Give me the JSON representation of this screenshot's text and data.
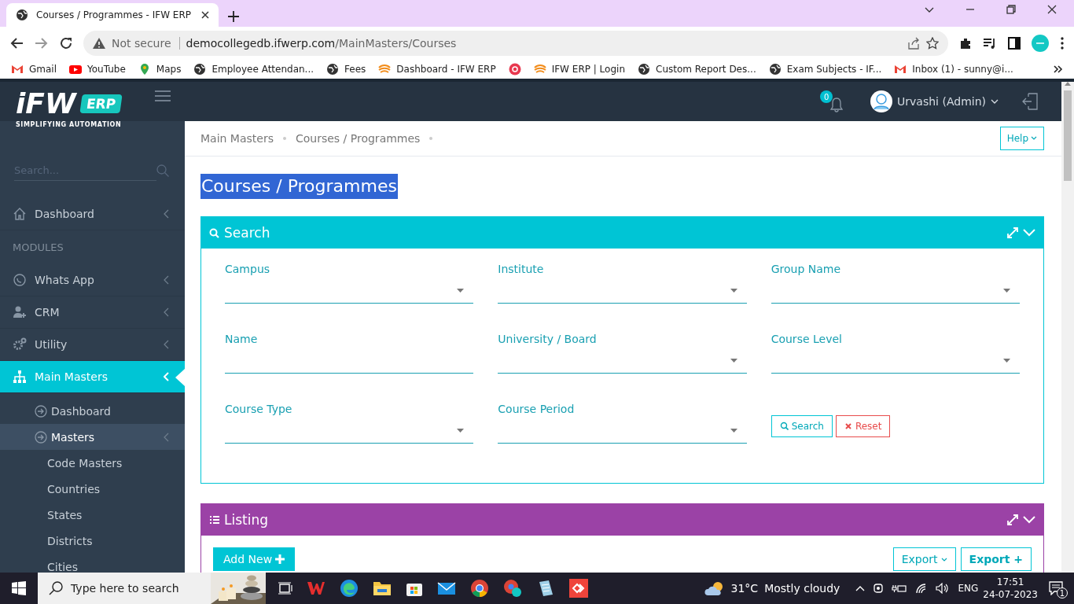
{
  "browser": {
    "tab": {
      "title": "Courses / Programmes - IFW ERP",
      "selected": true
    },
    "address": {
      "security": "Not secure",
      "host": "democollegedb.ifwerp.com",
      "path": "/MainMasters/Courses"
    },
    "bookmarks": [
      {
        "kind": "link",
        "label": "Gmail"
      },
      {
        "kind": "link",
        "label": "YouTube"
      },
      {
        "kind": "link",
        "label": "Maps"
      },
      {
        "kind": "link",
        "label": "Employee Attendan..."
      },
      {
        "kind": "link",
        "label": "Fees"
      },
      {
        "kind": "link",
        "label": "Dashboard - IFW ERP"
      },
      {
        "kind": "icon"
      },
      {
        "kind": "link",
        "label": "IFW ERP | Login"
      },
      {
        "kind": "link",
        "label": "Custom Report Des..."
      },
      {
        "kind": "link",
        "label": "Exam Subjects - IF..."
      },
      {
        "kind": "link",
        "label": "Inbox (1) - sunny@i..."
      }
    ]
  },
  "app": {
    "logo": {
      "name": "iFW",
      "badge": "ERP",
      "tagline": "SIMPLIFYING AUTOMATION"
    },
    "sidebar": {
      "search": {
        "placeholder": "Search..."
      },
      "items": [
        {
          "kind": "link",
          "label": "Dashboard",
          "selected": false
        },
        {
          "kind": "heading",
          "label": "MODULES"
        },
        {
          "kind": "link",
          "label": "Whats App",
          "selected": false
        },
        {
          "kind": "link",
          "label": "CRM",
          "selected": false
        },
        {
          "kind": "link",
          "label": "Utility",
          "selected": false
        },
        {
          "kind": "link",
          "label": "Main Masters",
          "selected": true,
          "children": [
            {
              "label": "Dashboard",
              "selected": false
            },
            {
              "label": "Masters",
              "selected": true,
              "children": [
                {
                  "label": "Code Masters",
                  "selected": false
                },
                {
                  "label": "Countries",
                  "selected": false
                },
                {
                  "label": "States",
                  "selected": false
                },
                {
                  "label": "Districts",
                  "selected": false
                },
                {
                  "label": "Cities",
                  "selected": false
                }
              ]
            }
          ]
        }
      ]
    },
    "header": {
      "notifications": "0",
      "user": "Urvashi (Admin)"
    },
    "breadcrumb": [
      "Main Masters",
      "Courses / Programmes"
    ],
    "help_button": "Help",
    "page_title": {
      "text": "Courses / Programmes",
      "highlighted": true
    },
    "panels": [
      {
        "kind": "search",
        "title": "Search",
        "color": "#00c5d5",
        "fields": [
          {
            "label": "Campus",
            "kind": "select"
          },
          {
            "label": "Institute",
            "kind": "select"
          },
          {
            "label": "Group Name",
            "kind": "select"
          },
          {
            "label": "Name",
            "kind": "text"
          },
          {
            "label": "University / Board",
            "kind": "select"
          },
          {
            "label": "Course Level",
            "kind": "select"
          },
          {
            "label": "Course Type",
            "kind": "select"
          },
          {
            "label": "Course Period",
            "kind": "select"
          }
        ],
        "buttons": [
          {
            "label": "Search",
            "kind": "search"
          },
          {
            "label": "Reset",
            "kind": "reset"
          }
        ]
      },
      {
        "kind": "listing",
        "title": "Listing",
        "color": "#9b42a6",
        "buttons": [
          {
            "label": "Add New",
            "kind": "add"
          },
          {
            "label": "Export",
            "kind": "dropdown"
          },
          {
            "label": "Export +",
            "kind": "outline"
          }
        ]
      }
    ]
  },
  "taskbar": {
    "search": {
      "placeholder": "Type here to search"
    },
    "weather": {
      "temperature": "31°C",
      "condition": "Mostly cloudy"
    },
    "language": "ENG",
    "time": "17:51",
    "date": "24-07-2023",
    "notifications": "1"
  }
}
